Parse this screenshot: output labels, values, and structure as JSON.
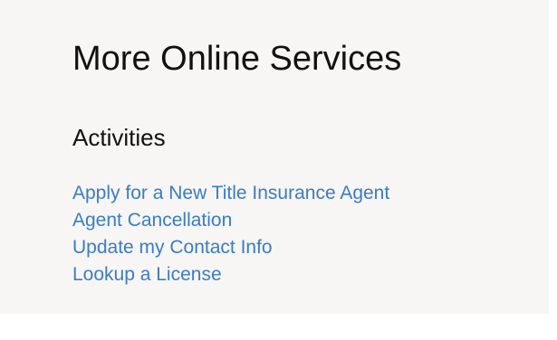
{
  "section": {
    "title": "More Online Services",
    "subtitle": "Activities",
    "links": [
      "Apply for a New Title Insurance Agent",
      "Agent Cancellation",
      "Update my Contact Info",
      "Lookup a License"
    ]
  },
  "colors": {
    "panel_background": "#f7f6f5",
    "heading_text": "#111111",
    "link_text": "#3a7cc6"
  }
}
